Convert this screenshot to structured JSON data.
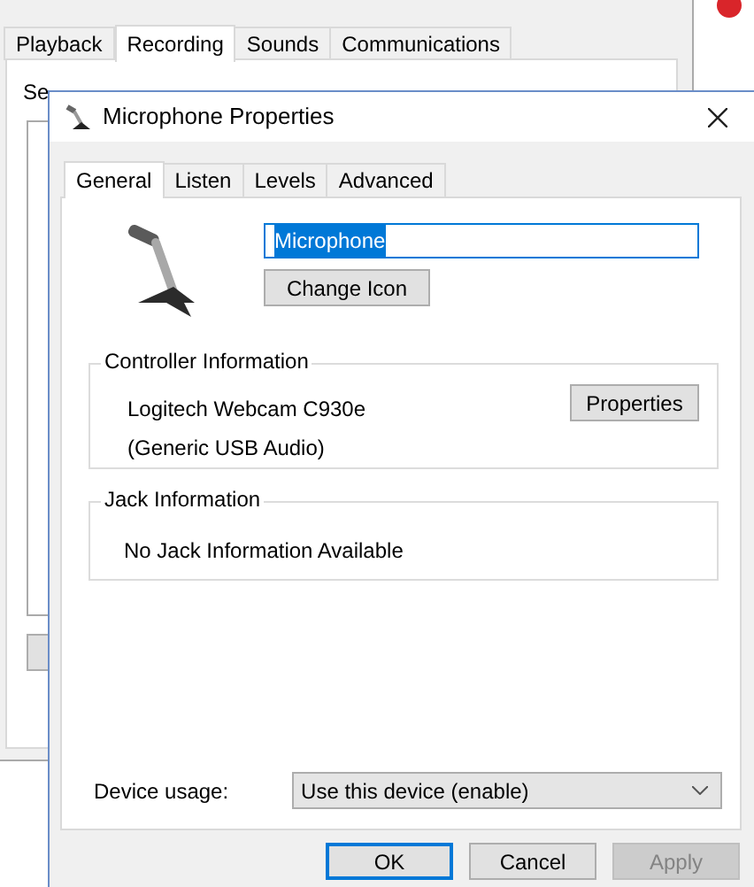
{
  "back_window": {
    "tabs": [
      {
        "label": "Playback",
        "selected": false
      },
      {
        "label": "Recording",
        "selected": true
      },
      {
        "label": "Sounds",
        "selected": false
      },
      {
        "label": "Communications",
        "selected": false
      }
    ],
    "instruction": "Se"
  },
  "dialog": {
    "title": "Microphone Properties",
    "tabs": [
      {
        "label": "General",
        "selected": true
      },
      {
        "label": "Listen",
        "selected": false
      },
      {
        "label": "Levels",
        "selected": false
      },
      {
        "label": "Advanced",
        "selected": false
      }
    ],
    "name_field": {
      "value": "Microphone",
      "text_selected": true
    },
    "change_icon_button": "Change Icon",
    "controller_information": {
      "title": "Controller Information",
      "lines": [
        "Logitech Webcam C930e",
        "(Generic USB Audio)"
      ],
      "button": "Properties"
    },
    "jack_information": {
      "title": "Jack Information",
      "text": "No Jack Information Available"
    },
    "device_usage": {
      "label": "Device usage:",
      "value": "Use this device (enable)"
    },
    "buttons": [
      {
        "label": "OK",
        "default": true,
        "disabled": false
      },
      {
        "label": "Cancel",
        "default": false,
        "disabled": false
      },
      {
        "label": "Apply",
        "default": false,
        "disabled": true
      }
    ]
  }
}
